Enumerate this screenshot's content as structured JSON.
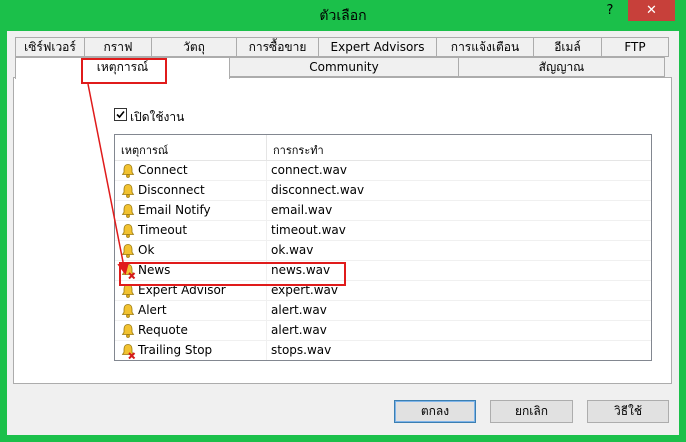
{
  "window": {
    "title": "ตัวเลือก",
    "help": "?",
    "close": "✕"
  },
  "tabs_row1": [
    "เซิร์ฟเวอร์",
    "กราฟ",
    "วัตถุ",
    "การซื้อขาย",
    "Expert Advisors",
    "การแจ้งเตือน",
    "อีเมล์",
    "FTP"
  ],
  "tabs_row2": [
    "เหตุการณ์",
    "Community",
    "สัญญาณ"
  ],
  "enable_label": "เปิดใช้งาน",
  "enable_checked": true,
  "table": {
    "col_event": "เหตุการณ์",
    "col_action": "การกระทำ",
    "rows": [
      {
        "event": "Connect",
        "action": "connect.wav",
        "icon": "bell-icon"
      },
      {
        "event": "Disconnect",
        "action": "disconnect.wav",
        "icon": "bell-icon"
      },
      {
        "event": "Email Notify",
        "action": "email.wav",
        "icon": "bell-icon"
      },
      {
        "event": "Timeout",
        "action": "timeout.wav",
        "icon": "bell-icon"
      },
      {
        "event": "Ok",
        "action": "ok.wav",
        "icon": "bell-icon"
      },
      {
        "event": "News",
        "action": "news.wav",
        "icon": "bell-disabled-icon"
      },
      {
        "event": "Expert Advisor",
        "action": "expert.wav",
        "icon": "bell-icon"
      },
      {
        "event": "Alert",
        "action": "alert.wav",
        "icon": "bell-icon"
      },
      {
        "event": "Requote",
        "action": "alert.wav",
        "icon": "bell-icon"
      },
      {
        "event": "Trailing Stop",
        "action": "stops.wav",
        "icon": "bell-disabled-icon"
      }
    ]
  },
  "buttons": {
    "ok": "ตกลง",
    "cancel": "ยกเลิก",
    "help": "วิธีใช้"
  },
  "colors": {
    "frame": "#1bc04a",
    "close": "#c7403a",
    "annotation": "#e01b1b"
  }
}
